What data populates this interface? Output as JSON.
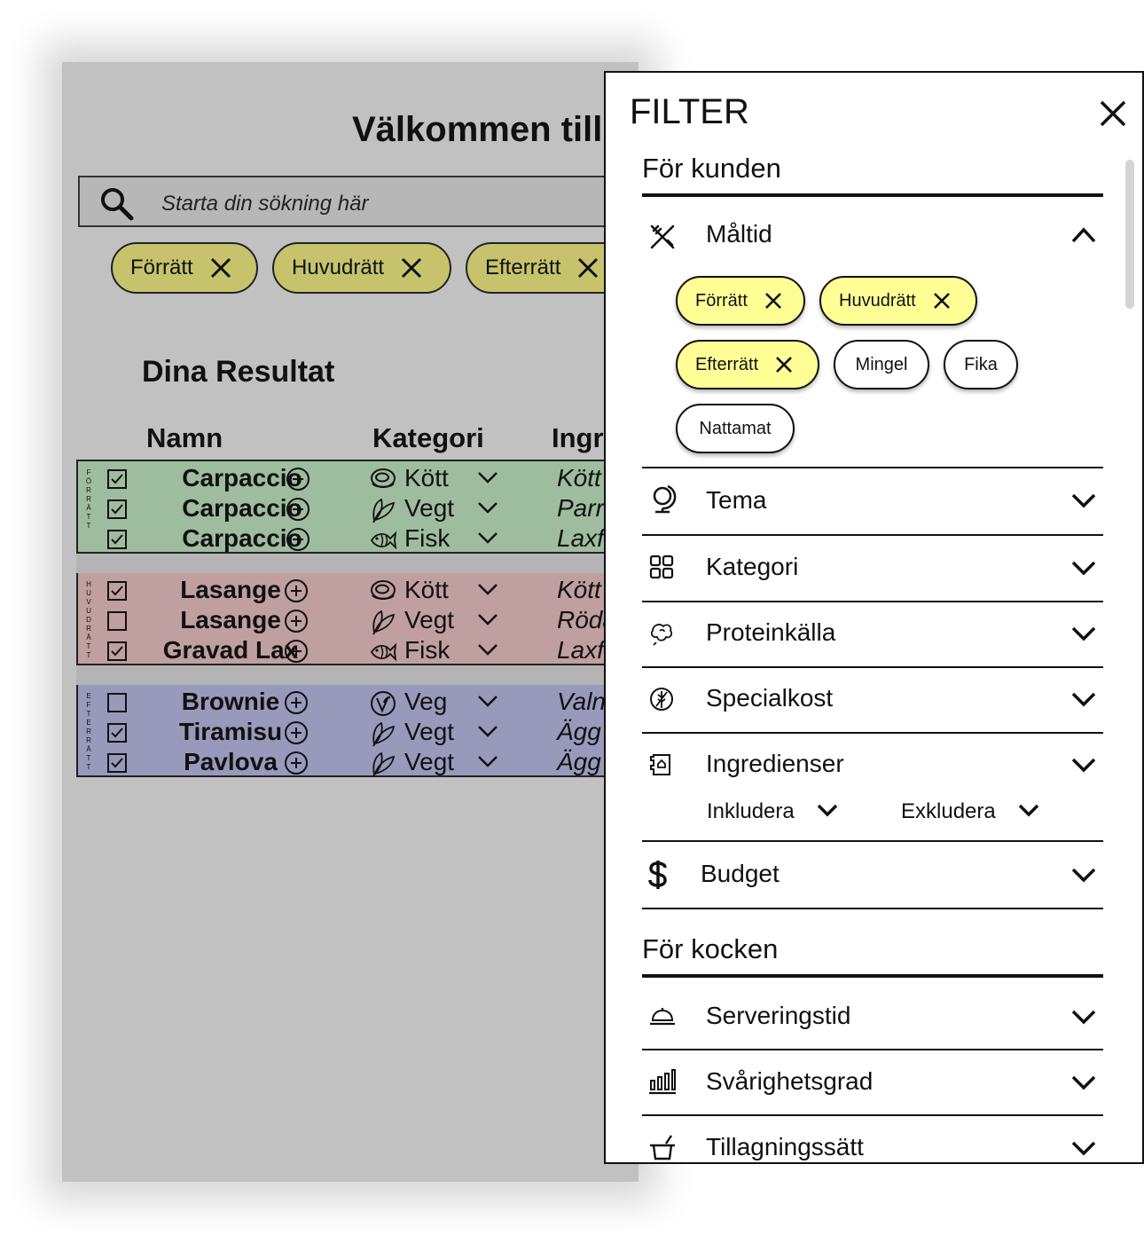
{
  "page": {
    "title": "Välkommen till",
    "search_placeholder": "Starta din sökning här",
    "active_filters": [
      "Förrätt",
      "Huvudrätt",
      "Efterrätt"
    ],
    "results_title": "Dina Resultat",
    "columns": [
      "Namn",
      "Kategori",
      "Ingr"
    ],
    "groups": [
      {
        "label": "FÖRRÄTT",
        "color": "#9ebd9e",
        "rows": [
          {
            "checked": true,
            "name": "Carpaccio",
            "category_icon": "meat-icon",
            "category": "Kött",
            "ingredient": "Kött"
          },
          {
            "checked": true,
            "name": "Carpaccio",
            "category_icon": "leaf-icon",
            "category": "Vegt",
            "ingredient": "Parr"
          },
          {
            "checked": true,
            "name": "Carpaccio",
            "category_icon": "fish-icon",
            "category": "Fisk",
            "ingredient": "Laxf"
          }
        ]
      },
      {
        "label": "HUVUDRÄTT",
        "color": "#bf9f9f",
        "rows": [
          {
            "checked": true,
            "name": "Lasange",
            "category_icon": "meat-icon",
            "category": "Kött",
            "ingredient": "Kött"
          },
          {
            "checked": false,
            "name": "Lasange",
            "category_icon": "leaf-icon",
            "category": "Vegt",
            "ingredient": "Röda"
          },
          {
            "checked": true,
            "name": "Gravad Lax",
            "category_icon": "fish-icon",
            "category": "Fisk",
            "ingredient": "Laxf"
          }
        ]
      },
      {
        "label": "EFTERRÄTT",
        "color": "#9999bb",
        "rows": [
          {
            "checked": false,
            "name": "Brownie",
            "category_icon": "vegan-icon",
            "category": "Veg",
            "ingredient": "Valn"
          },
          {
            "checked": true,
            "name": "Tiramisu",
            "category_icon": "leaf-icon",
            "category": "Vegt",
            "ingredient": "Ägg"
          },
          {
            "checked": true,
            "name": "Pavlova",
            "category_icon": "leaf-icon",
            "category": "Vegt",
            "ingredient": "Ägg"
          }
        ]
      }
    ]
  },
  "filter": {
    "title": "FILTER",
    "customer_section": "För kunden",
    "chef_section": "För kocken",
    "maltid": {
      "label": "Måltid",
      "options": [
        {
          "label": "Förrätt",
          "selected": true
        },
        {
          "label": "Huvudrätt",
          "selected": true
        },
        {
          "label": "Efterrätt",
          "selected": true
        },
        {
          "label": "Mingel",
          "selected": false
        },
        {
          "label": "Fika",
          "selected": false
        },
        {
          "label": "Nattamat",
          "selected": false
        }
      ]
    },
    "customer_items": [
      "Tema",
      "Kategori",
      "Proteinkälla",
      "Specialkost",
      "Ingredienser",
      "Budget"
    ],
    "ingredient_options": {
      "include": "Inkludera",
      "exclude": "Exkludera"
    },
    "chef_items": [
      "Serveringstid",
      "Svårighetsgrad",
      "Tillagningssätt"
    ]
  },
  "colors": {
    "selected_chip": "#ffff96",
    "dimmed_chip": "#c6c36c",
    "overlay": "#c1c1c1"
  }
}
